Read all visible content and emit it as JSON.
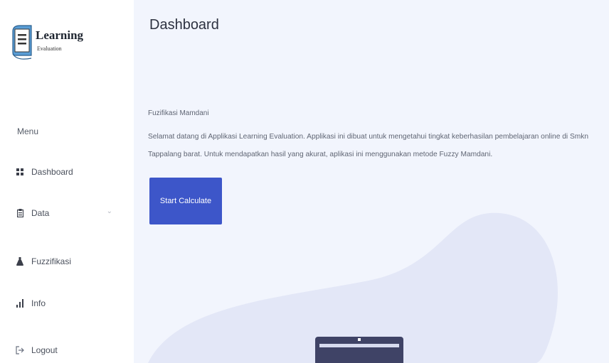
{
  "brand": {
    "title": "Learning",
    "subtitle": "Evaluation"
  },
  "sidebar": {
    "menu_heading": "Menu",
    "items": [
      {
        "label": "Dashboard",
        "icon": "grid-icon"
      },
      {
        "label": "Data",
        "icon": "clipboard-icon",
        "has_submenu": true
      },
      {
        "label": "Fuzzifikasi",
        "icon": "flask-icon"
      },
      {
        "label": "Info",
        "icon": "bar-chart-icon"
      },
      {
        "label": "Logout",
        "icon": "logout-icon"
      }
    ]
  },
  "main": {
    "title": "Dashboard",
    "intro_heading": "Fuzifikasi Mamdani",
    "intro_text": "Selamat datang di Applikasi Learning Evaluation. Applikasi ini dibuat untuk mengetahui tingkat keberhasilan pembelajaran online di Smkn Tappalang barat. Untuk mendapatkan hasil yang akurat, aplikasi ini menggunakan metode Fuzzy Mamdani.",
    "start_button": "Start Calculate"
  },
  "colors": {
    "accent": "#3d56c9",
    "main_background": "#f2f5fd",
    "blob": "#e3e7f7"
  }
}
